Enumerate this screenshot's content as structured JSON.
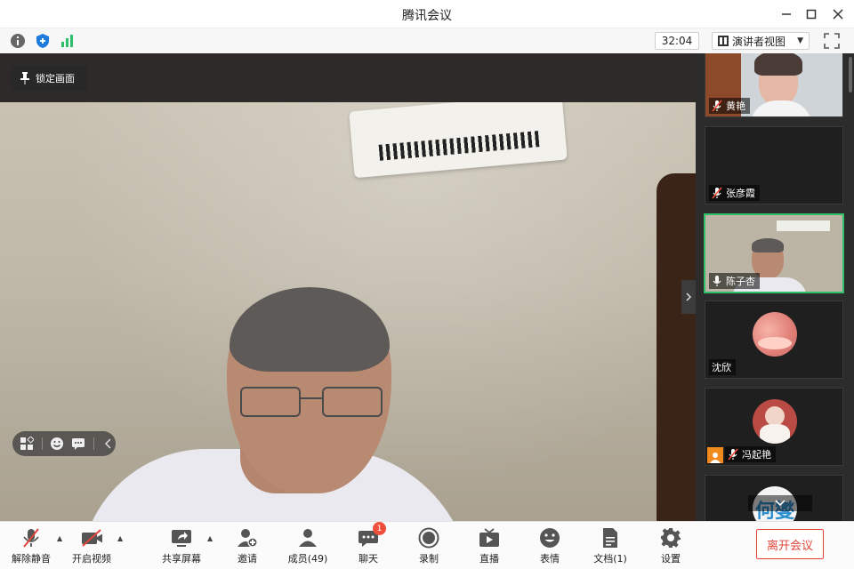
{
  "window": {
    "title": "腾讯会议"
  },
  "status": {
    "timer": "32:04",
    "view_mode": "演讲者视图"
  },
  "main": {
    "lock_label": "锁定画面"
  },
  "participants": [
    {
      "name": "黄艳",
      "muted": true
    },
    {
      "name": "张彦霞",
      "muted": true
    },
    {
      "name": "陈子杏",
      "muted": false,
      "active": true
    },
    {
      "name": "沈欣",
      "muted": null
    },
    {
      "name": "冯起艳",
      "muted": true,
      "host": true
    },
    {
      "name": "何燮",
      "muted": null
    }
  ],
  "toolbar": {
    "unmute": "解除静音",
    "start_video": "开启视频",
    "share": "共享屏幕",
    "invite": "邀请",
    "members": "成员(49)",
    "chat": "聊天",
    "chat_badge": "1",
    "record": "录制",
    "live": "直播",
    "reactions": "表情",
    "docs": "文档(1)",
    "settings": "设置",
    "leave": "离开会议"
  },
  "colors": {
    "accent_green": "#2fbe6a",
    "leave_red": "#e0453b",
    "badge_red": "#f04f3b"
  }
}
